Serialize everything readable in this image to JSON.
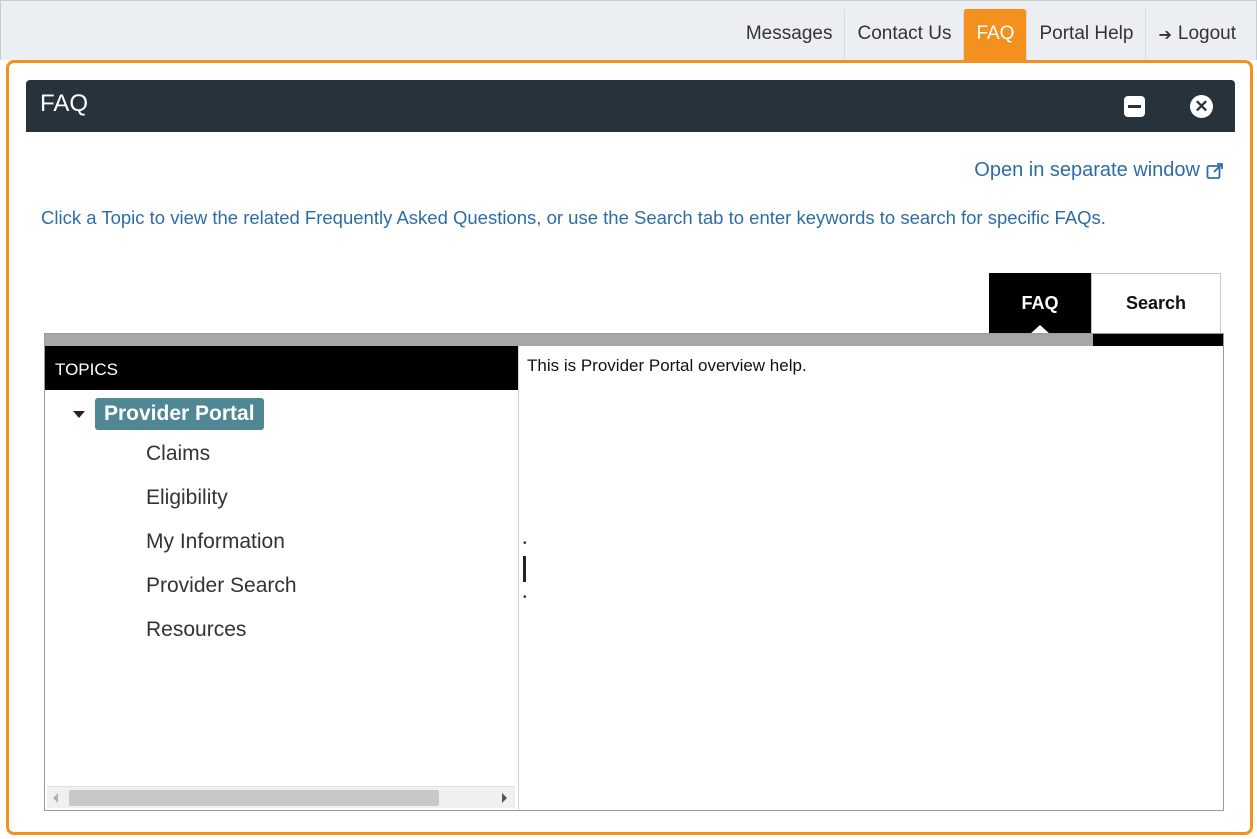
{
  "topnav": {
    "items": [
      {
        "label": "Messages"
      },
      {
        "label": "Contact Us"
      },
      {
        "label": "FAQ"
      },
      {
        "label": "Portal Help"
      },
      {
        "label": "Logout",
        "icon": "logout-icon"
      }
    ],
    "active": "FAQ"
  },
  "window": {
    "title": "FAQ",
    "minimize_icon": "minimize-icon",
    "close_icon": "close-icon",
    "open_separate_label": "Open in separate window",
    "intro_text": "Click a Topic to view the related Frequently Asked Questions, or use the Search tab to enter keywords to search for specific FAQs."
  },
  "tabs": [
    {
      "label": "FAQ",
      "active": true
    },
    {
      "label": "Search",
      "active": false
    }
  ],
  "topics": {
    "header": "TOPICS",
    "root": "Provider Portal",
    "children": [
      "Claims",
      "Eligibility",
      "My Information",
      "Provider Search",
      "Resources"
    ]
  },
  "content": {
    "text": "This is Provider Portal overview help."
  },
  "colors": {
    "accent": "#f4911e",
    "titlebar": "#26333d",
    "link": "#2e6da4",
    "tree_selected": "#4f8795"
  }
}
